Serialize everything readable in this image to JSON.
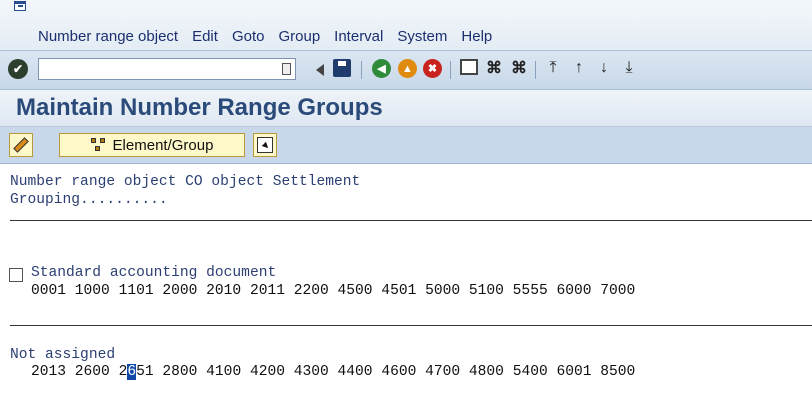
{
  "menu": {
    "items": [
      "Number range object",
      "Edit",
      "Goto",
      "Group",
      "Interval",
      "System",
      "Help"
    ]
  },
  "toolbar": {
    "command_field_value": "",
    "icons": [
      "enter-icon",
      "command-field",
      "back-arrow-icon",
      "save-icon",
      "back-icon",
      "exit-icon",
      "cancel-icon",
      "print-icon",
      "find-icon",
      "find-next-icon",
      "first-page-icon",
      "previous-page-icon",
      "next-page-icon",
      "last-page-icon"
    ],
    "enter_glyph": "✔"
  },
  "title": "Maintain Number Range Groups",
  "app_toolbar": {
    "element_group_label": "Element/Group"
  },
  "content": {
    "object_line": "Number range object CO object Settlement",
    "grouping_line": "Grouping..........",
    "groups": [
      {
        "name": "Standard accounting document",
        "numbers": "0001 1000 1101 2000 2010 2011 2200 4500 4501 5000 5100 5555 6000 7000"
      },
      {
        "name": "Not assigned",
        "numbers_before_cursor": "2013 2600 2",
        "cursor_char": "6",
        "numbers_after_cursor": "51 2800 4100 4200 4300 4400 4600 4700 4800 5400 6001 8500"
      }
    ]
  },
  "colors": {
    "title": "#2a4a7a",
    "text_blue": "#2b3f73",
    "cursor": "#1048a8",
    "button_bg": "#fff8c8"
  }
}
